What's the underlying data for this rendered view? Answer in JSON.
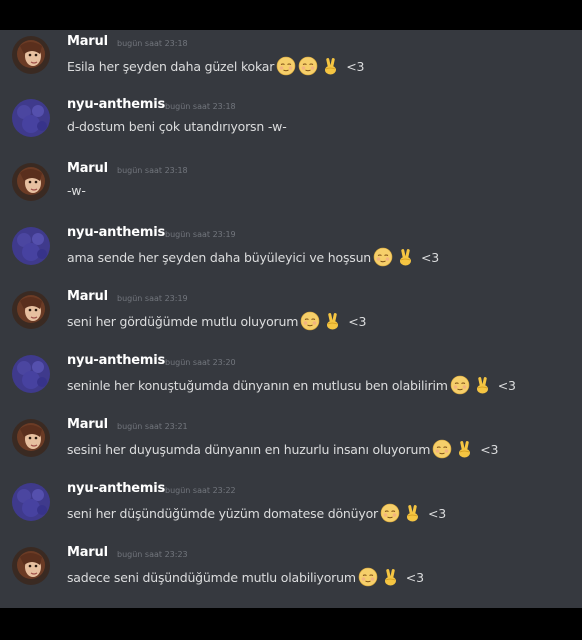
{
  "messages": [
    {
      "author": "Marul",
      "time": "bugün saat 23:18",
      "text": "Esila her şeyden daha güzel kokar",
      "emojis": [
        "relieved-face-icon",
        "relieved-face-icon",
        "victory-hand-icon"
      ],
      "suffix": "<3"
    },
    {
      "author": "nyu-anthemis",
      "time": "bugün saat 23:18",
      "text": "d-dostum beni çok utandırıyorsn -w-",
      "emojis": [],
      "suffix": ""
    },
    {
      "author": "Marul",
      "time": "bugün saat 23:18",
      "text": "-w-",
      "emojis": [],
      "suffix": ""
    },
    {
      "author": "nyu-anthemis",
      "time": "bugün saat 23:19",
      "text": "ama sende her şeyden daha büyüleyici ve hoşsun",
      "emojis": [
        "relieved-face-icon",
        "victory-hand-icon"
      ],
      "suffix": "<3"
    },
    {
      "author": "Marul",
      "time": "bugün saat 23:19",
      "text": "seni her gördüğümde mutlu oluyorum",
      "emojis": [
        "relieved-face-icon",
        "victory-hand-icon"
      ],
      "suffix": "<3"
    },
    {
      "author": "nyu-anthemis",
      "time": "bugün saat 23:20",
      "text": "seninle her konuştuğumda dünyanın en mutlusu ben olabilirim",
      "emojis": [
        "relieved-face-icon",
        "victory-hand-icon"
      ],
      "suffix": "<3"
    },
    {
      "author": "Marul",
      "time": "bugün saat 23:21",
      "text": "sesini her duyuşumda dünyanın en huzurlu insanı oluyorum",
      "emojis": [
        "relieved-face-icon",
        "victory-hand-icon"
      ],
      "suffix": "<3"
    },
    {
      "author": "nyu-anthemis",
      "time": "bugün saat 23:22",
      "text": "seni her düşündüğümde yüzüm domatese dönüyor",
      "emojis": [
        "relieved-face-icon",
        "victory-hand-icon"
      ],
      "suffix": "<3"
    },
    {
      "author": "Marul",
      "time": "bugün saat 23:23",
      "text": "sadece seni düşündüğümde mutlu olabiliyorum",
      "emojis": [
        "relieved-face-icon",
        "victory-hand-icon"
      ],
      "suffix": "<3"
    }
  ],
  "colors": {
    "background": "#36393f",
    "author": "#ffffff",
    "timestamp": "#72767d",
    "text": "#dcddde",
    "nyu_avatar": "#3f3a8c"
  }
}
